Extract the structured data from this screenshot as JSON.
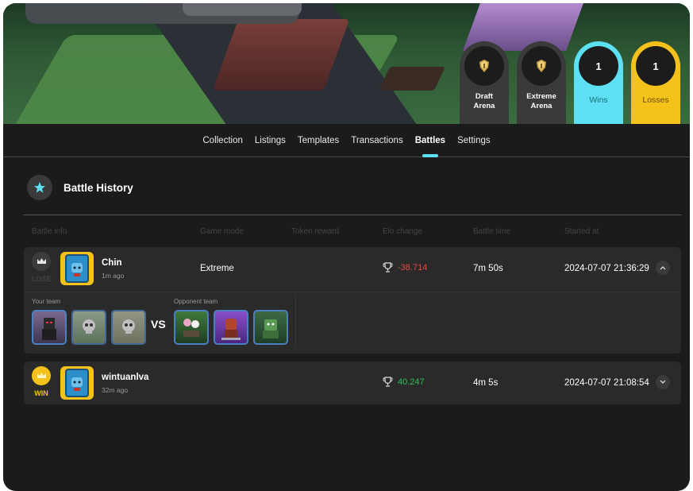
{
  "header": {
    "stats": [
      {
        "label_line1": "Draft",
        "label_line2": "Arena",
        "kind": "arena",
        "icon": "arena-shield-icon"
      },
      {
        "label_line1": "Extreme",
        "label_line2": "Arena",
        "kind": "arena",
        "icon": "arena-shield-icon"
      },
      {
        "value": "1",
        "label": "Wins",
        "color": "#5de1f2"
      },
      {
        "value": "1",
        "label": "Losses",
        "color": "#f4c21a"
      }
    ]
  },
  "tabs": [
    {
      "label": "Collection"
    },
    {
      "label": "Listings"
    },
    {
      "label": "Templates"
    },
    {
      "label": "Transactions"
    },
    {
      "label": "Battles",
      "active": true
    },
    {
      "label": "Settings"
    }
  ],
  "history": {
    "title": "Battle History",
    "title_icon": "star-icon",
    "columns": [
      "Battle info",
      "Game mode",
      "Token reward",
      "Elo change",
      "Battle time",
      "Started at"
    ],
    "battles": [
      {
        "result": "LOSE",
        "player": "Chin",
        "time_ago": "1m ago",
        "game_mode": "Extreme",
        "elo_change": "-38.714",
        "battle_time": "7m 50s",
        "started_at": "2024-07-07 21:36:29",
        "expanded": true,
        "your_team_label": "Your team",
        "opponent_team_label": "Opponent team",
        "vs_label": "VS"
      },
      {
        "result": "WIN",
        "player": "wintuanlva",
        "time_ago": "32m ago",
        "game_mode": "",
        "elo_change": "40.247",
        "battle_time": "4m 5s",
        "started_at": "2024-07-07 21:08:54",
        "expanded": false
      }
    ]
  },
  "colors": {
    "accent": "#5de1f2",
    "win": "#f4c21a",
    "negative": "#e24b45",
    "positive": "#2fbf5a"
  }
}
